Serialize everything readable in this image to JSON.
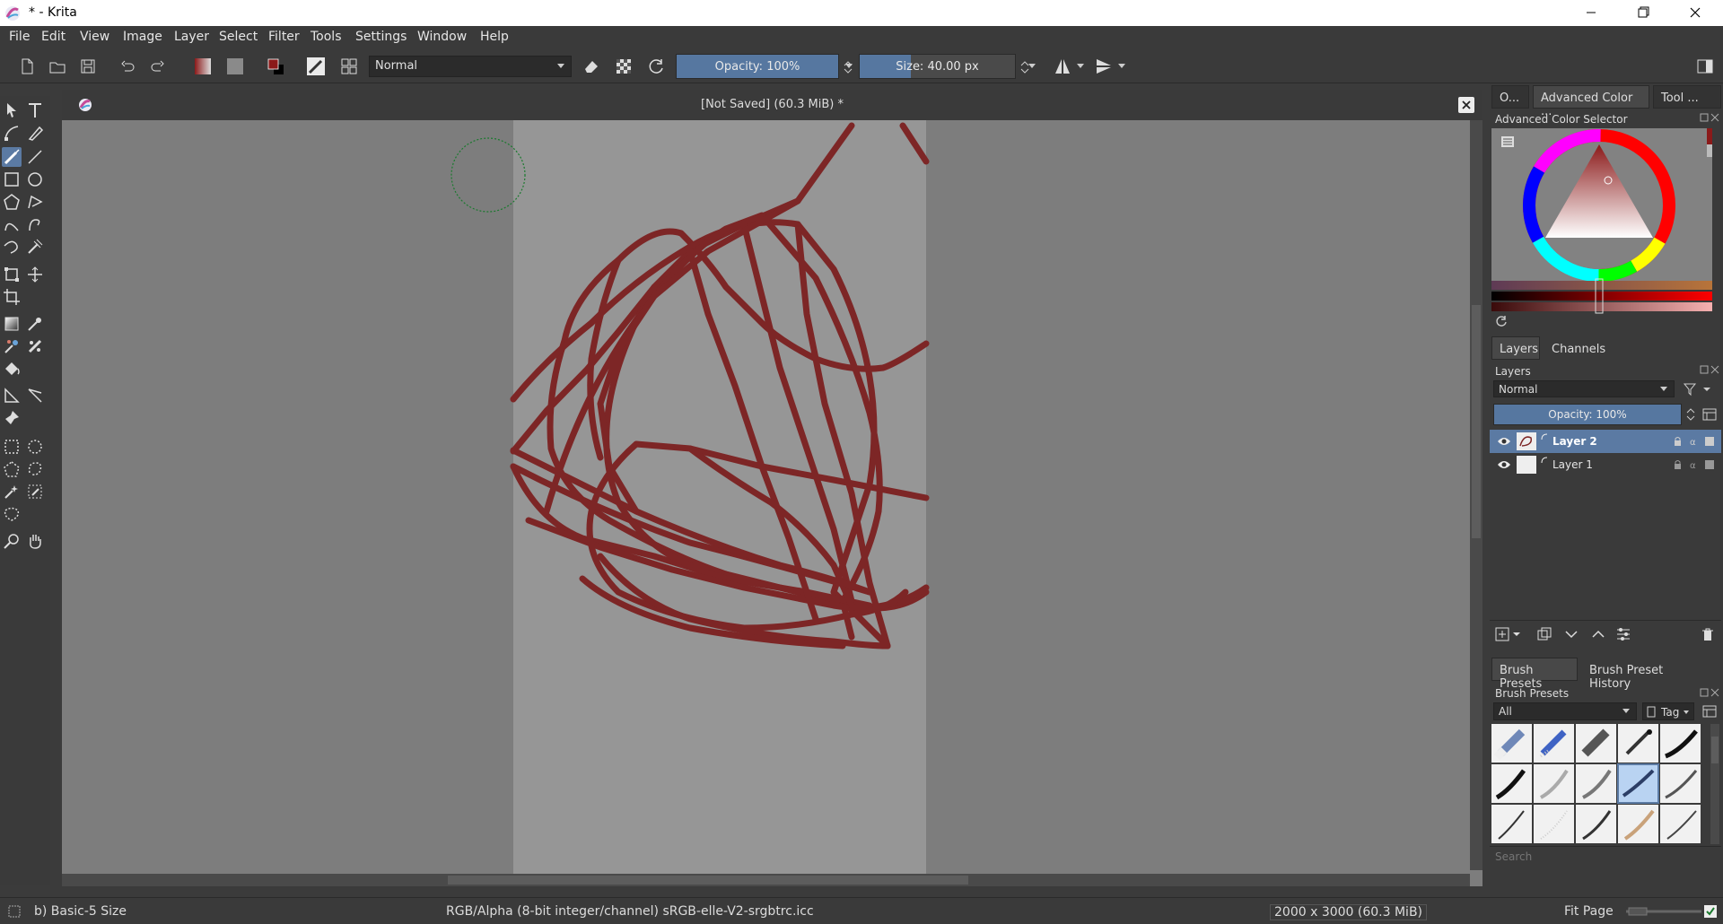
{
  "window": {
    "title": "* - Krita"
  },
  "menu": [
    "File",
    "Edit",
    "View",
    "Image",
    "Layer",
    "Select",
    "Filter",
    "Tools",
    "Settings",
    "Window",
    "Help"
  ],
  "toolbar": {
    "blend_mode": "Normal",
    "opacity_label": "Opacity: 100%",
    "opacity": 1.0,
    "size_label": "Size: 40.00 px",
    "size_fraction": 0.33
  },
  "document": {
    "tab_title": "[Not Saved]  (60.3 MiB) *"
  },
  "docker": {
    "top_tabs": [
      "O...",
      "Advanced Color ...",
      "Tool ..."
    ],
    "color_selector_title": "Advanced Color Selector",
    "layers_tabs": [
      "Layers",
      "Channels"
    ],
    "layers_title": "Layers",
    "layers_blend": "Normal",
    "layers_opacity": "Opacity:  100%",
    "layers": [
      {
        "name": "Layer 2",
        "selected": true
      },
      {
        "name": "Layer 1",
        "selected": false
      }
    ],
    "presets_tabs": [
      "Brush Presets",
      "Brush Preset History"
    ],
    "presets_title": "Brush Presets",
    "presets_filter": "All",
    "presets_tag": "Tag",
    "presets_search_placeholder": "Search"
  },
  "status": {
    "brush": "b) Basic-5 Size",
    "color_space": "RGB/Alpha (8-bit integer/channel)  sRGB-elle-V2-srgbtrc.icc",
    "dimensions": "2000 x 3000 (60.3 MiB)",
    "zoom": "Fit Page"
  },
  "colors": {
    "stroke": "#7d2626",
    "accent": "#5677a0",
    "fg_color": "#8b1a1a",
    "bg_color": "#000000"
  }
}
